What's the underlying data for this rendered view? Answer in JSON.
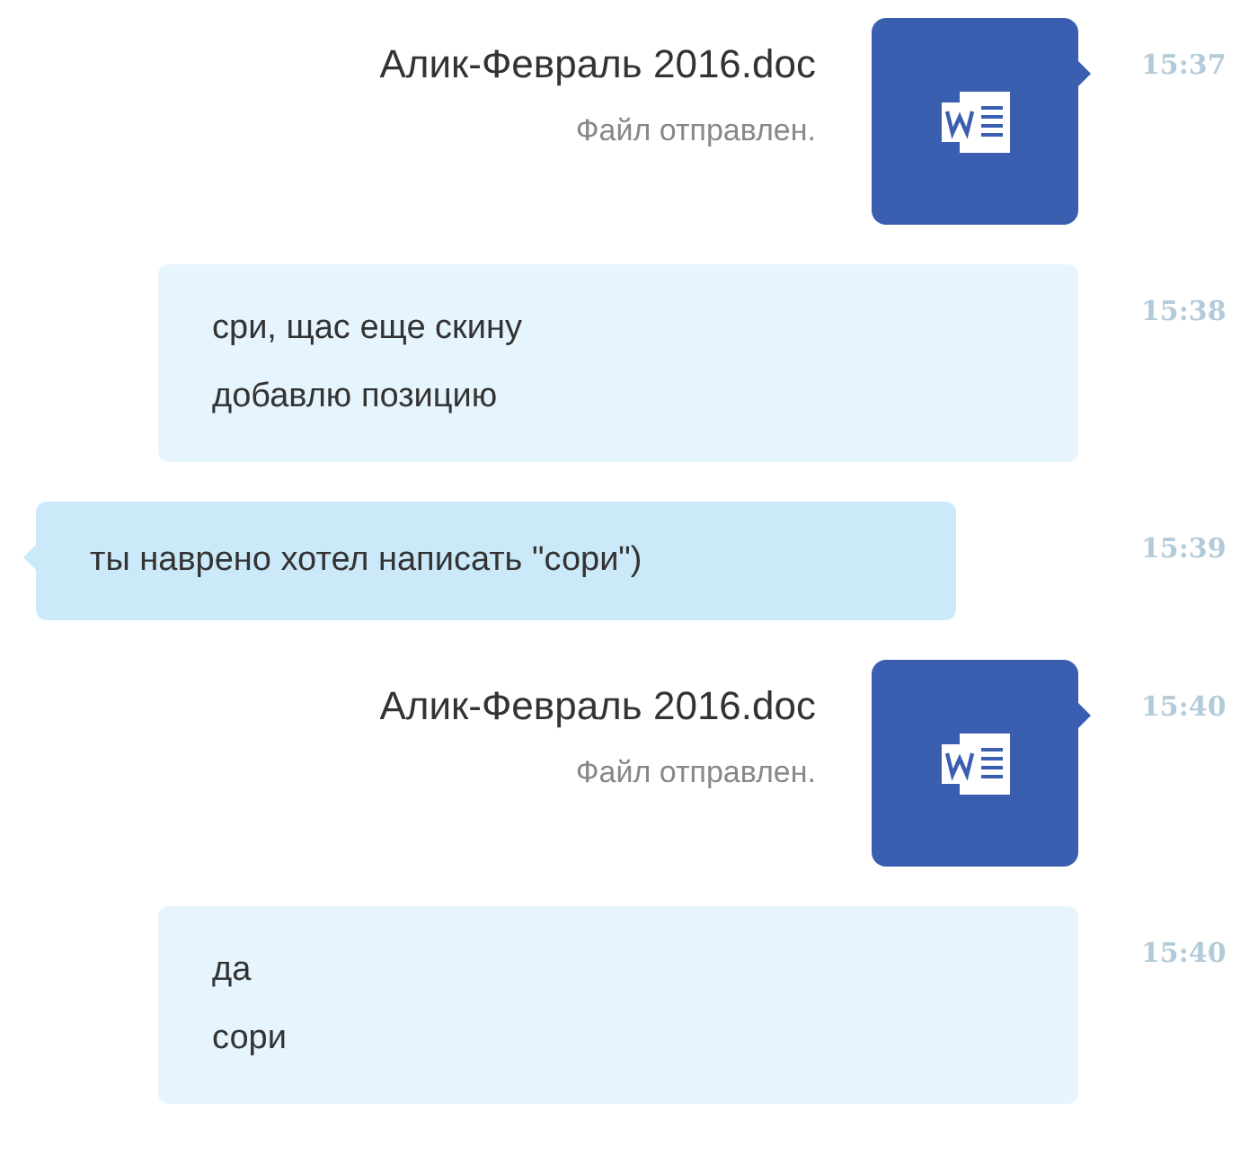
{
  "messages": [
    {
      "kind": "file",
      "outgoing": true,
      "filename": "Алик-Февраль 2016.doc",
      "status": "Файл отправлен.",
      "time": "15:37"
    },
    {
      "kind": "text",
      "outgoing": true,
      "lines": [
        "сри, щас еще скину",
        "добавлю позицию"
      ],
      "time": "15:38"
    },
    {
      "kind": "text",
      "outgoing": false,
      "lines": [
        "ты наврено хотел написать \"сори\")"
      ],
      "time": "15:39"
    },
    {
      "kind": "file",
      "outgoing": true,
      "filename": "Алик-Февраль 2016.doc",
      "status": "Файл отправлен.",
      "time": "15:40"
    },
    {
      "kind": "text",
      "outgoing": true,
      "lines": [
        "да",
        "сори"
      ],
      "time": "15:40"
    }
  ]
}
